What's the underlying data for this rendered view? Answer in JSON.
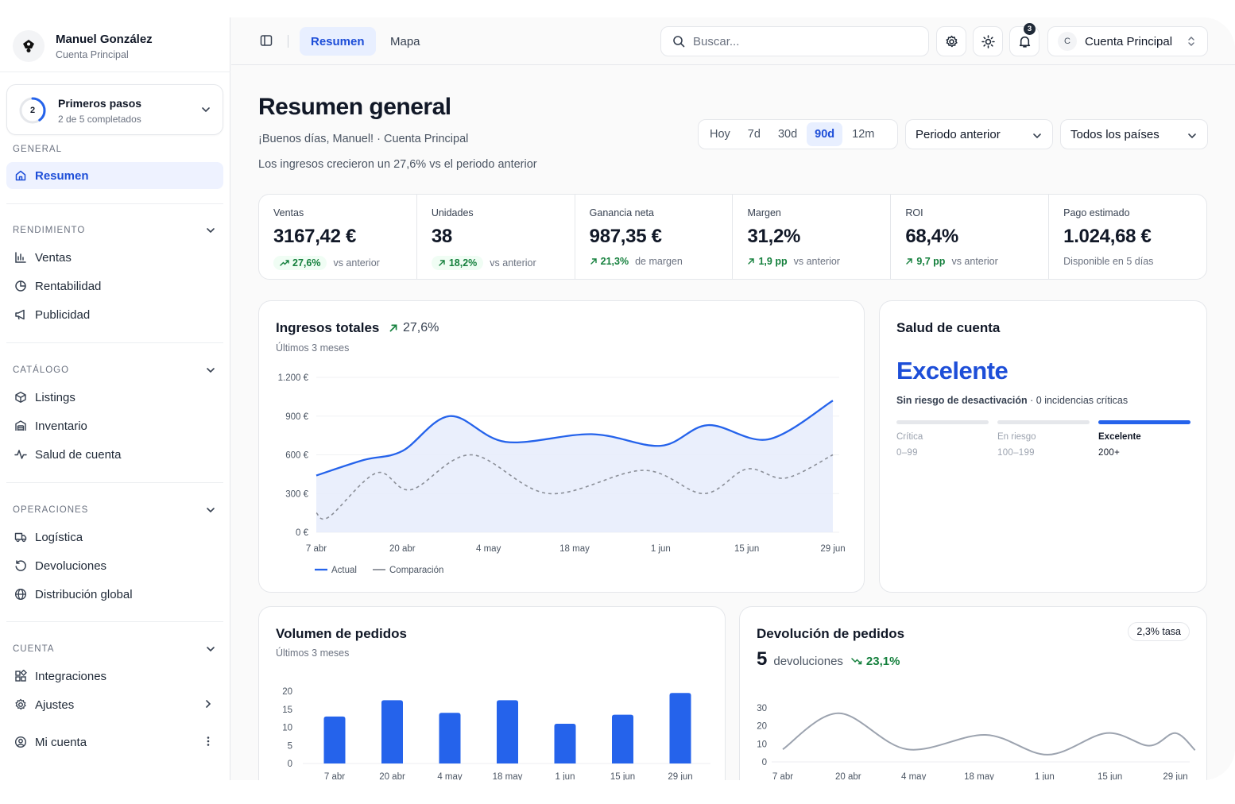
{
  "user": {
    "name": "Manuel González",
    "account": "Cuenta Principal"
  },
  "onboarding": {
    "done": 2,
    "total": 5,
    "title": "Primeros pasos",
    "progress_text": "2 de 5 completados"
  },
  "sidebar": {
    "general": {
      "label": "GENERAL",
      "items": [
        {
          "label": "Resumen",
          "icon": "home-icon"
        }
      ]
    },
    "rendimiento": {
      "label": "RENDIMIENTO",
      "items": [
        {
          "label": "Ventas",
          "icon": "bar-chart-icon"
        },
        {
          "label": "Rentabilidad",
          "icon": "pie-chart-icon"
        },
        {
          "label": "Publicidad",
          "icon": "megaphone-icon"
        }
      ]
    },
    "catalogo": {
      "label": "CATÁLOGO",
      "items": [
        {
          "label": "Listings",
          "icon": "package-icon"
        },
        {
          "label": "Inventario",
          "icon": "warehouse-icon"
        },
        {
          "label": "Salud de cuenta",
          "icon": "activity-icon"
        }
      ]
    },
    "operaciones": {
      "label": "OPERACIONES",
      "items": [
        {
          "label": "Logística",
          "icon": "truck-icon"
        },
        {
          "label": "Devoluciones",
          "icon": "rotate-icon"
        },
        {
          "label": "Distribución global",
          "icon": "globe-icon"
        }
      ]
    },
    "cuenta": {
      "label": "CUENTA",
      "items": [
        {
          "label": "Integraciones",
          "icon": "blocks-icon"
        },
        {
          "label": "Ajustes",
          "icon": "gear-icon"
        }
      ]
    },
    "footer": {
      "label": "Mi cuenta",
      "icon": "user-circle-icon"
    }
  },
  "topbar": {
    "tabs": [
      {
        "label": "Resumen",
        "active": true
      },
      {
        "label": "Mapa",
        "active": false
      }
    ],
    "search_placeholder": "Buscar...",
    "notifications": "3",
    "account_initial": "C",
    "account_name": "Cuenta Principal"
  },
  "header": {
    "title": "Resumen general",
    "greeting": "¡Buenos días, Manuel! · Cuenta Principal",
    "note": "Los ingresos crecieron un 27,6% vs el periodo anterior"
  },
  "filters": {
    "ranges": [
      "Hoy",
      "7d",
      "30d",
      "90d",
      "12m"
    ],
    "active_range": "90d",
    "comparison": "Periodo anterior",
    "country": "Todos los países"
  },
  "kpis": [
    {
      "label": "Ventas",
      "value": "3167,42 €",
      "delta": "27,6%",
      "sub": "vs anterior",
      "pill": true
    },
    {
      "label": "Unidades",
      "value": "38",
      "delta": "18,2%",
      "sub": "vs anterior",
      "pill": true
    },
    {
      "label": "Ganancia neta",
      "value": "987,35 €",
      "delta": "21,3%",
      "sub": "de margen",
      "pill": false
    },
    {
      "label": "Margen",
      "value": "31,2%",
      "delta": "1,9 pp",
      "sub": "vs anterior",
      "pill": false
    },
    {
      "label": "ROI",
      "value": "68,4%",
      "delta": "9,7 pp",
      "sub": "vs anterior",
      "pill": false
    },
    {
      "label": "Pago estimado",
      "value": "1.024,68 €",
      "delta": "",
      "sub": "Disponible en 5 días",
      "pill": false
    }
  ],
  "revenue_card": {
    "title": "Ingresos totales",
    "delta": "27,6%",
    "subtitle": "Últimos 3 meses"
  },
  "health_card": {
    "title": "Salud de cuenta",
    "status": "Excelente",
    "desc_bold": "Sin riesgo de desactivación",
    "desc_rest": " · 0 incidencias críticas",
    "tiers": [
      {
        "name": "Crítica",
        "range": "0–99",
        "active": false
      },
      {
        "name": "En riesgo",
        "range": "100–199",
        "active": false
      },
      {
        "name": "Excelente",
        "range": "200+",
        "active": true
      }
    ]
  },
  "orders_card": {
    "title": "Volumen de pedidos",
    "subtitle": "Últimos 3 meses"
  },
  "returns_card": {
    "title": "Devolución de pedidos",
    "count": "5",
    "count_label": "devoluciones",
    "delta": "23,1%",
    "rate": "2,3% tasa"
  },
  "colors": {
    "accent": "#2563eb",
    "positive": "#15803d",
    "area": "#e6ecfb"
  },
  "chart_data": [
    {
      "type": "area",
      "x": [
        "7 abr",
        "20 abr",
        "4 may",
        "18 may",
        "1 jun",
        "15 jun",
        "29 jun"
      ],
      "ylim": [
        0,
        1200
      ],
      "yticks": [
        "0 €",
        "300 €",
        "600 €",
        "900 €",
        "1.200 €"
      ],
      "series": [
        {
          "name": "Actual",
          "style": "solid",
          "points": [
            [
              0,
              440
            ],
            [
              0.55,
              560
            ],
            [
              1,
              630
            ],
            [
              1.55,
              900
            ],
            [
              2.2,
              700
            ],
            [
              3.2,
              760
            ],
            [
              4.0,
              670
            ],
            [
              4.55,
              830
            ],
            [
              5.25,
              720
            ],
            [
              6.0,
              1020
            ]
          ]
        },
        {
          "name": "Comparación",
          "style": "dashed",
          "points": [
            [
              0,
              150
            ],
            [
              0.15,
              120
            ],
            [
              0.7,
              460
            ],
            [
              1.1,
              330
            ],
            [
              1.8,
              600
            ],
            [
              2.7,
              300
            ],
            [
              3.8,
              480
            ],
            [
              4.5,
              300
            ],
            [
              5.0,
              490
            ],
            [
              5.45,
              420
            ],
            [
              6.0,
              600
            ]
          ]
        }
      ],
      "legend": [
        "Actual",
        "Comparación"
      ]
    },
    {
      "type": "bar",
      "categories": [
        "7 abr",
        "20 abr",
        "4 may",
        "18 may",
        "1 jun",
        "15 jun",
        "29 jun"
      ],
      "values": [
        13,
        17.5,
        14,
        17.5,
        11,
        13.5,
        19.5
      ],
      "ylim": [
        0,
        20
      ],
      "yticks": [
        "0",
        "5",
        "10",
        "15",
        "20"
      ]
    },
    {
      "type": "line",
      "x": [
        "7 abr",
        "20 abr",
        "4 may",
        "18 may",
        "1 jun",
        "15 jun",
        "29 jun"
      ],
      "ylim": [
        0,
        30
      ],
      "yticks": [
        "0",
        "10",
        "20",
        "30"
      ],
      "points": [
        [
          0,
          7
        ],
        [
          0.85,
          27
        ],
        [
          1.9,
          7
        ],
        [
          3.1,
          15
        ],
        [
          4.05,
          4
        ],
        [
          4.95,
          16
        ],
        [
          5.6,
          9
        ],
        [
          6.0,
          16
        ],
        [
          6.3,
          6.5
        ]
      ]
    }
  ]
}
